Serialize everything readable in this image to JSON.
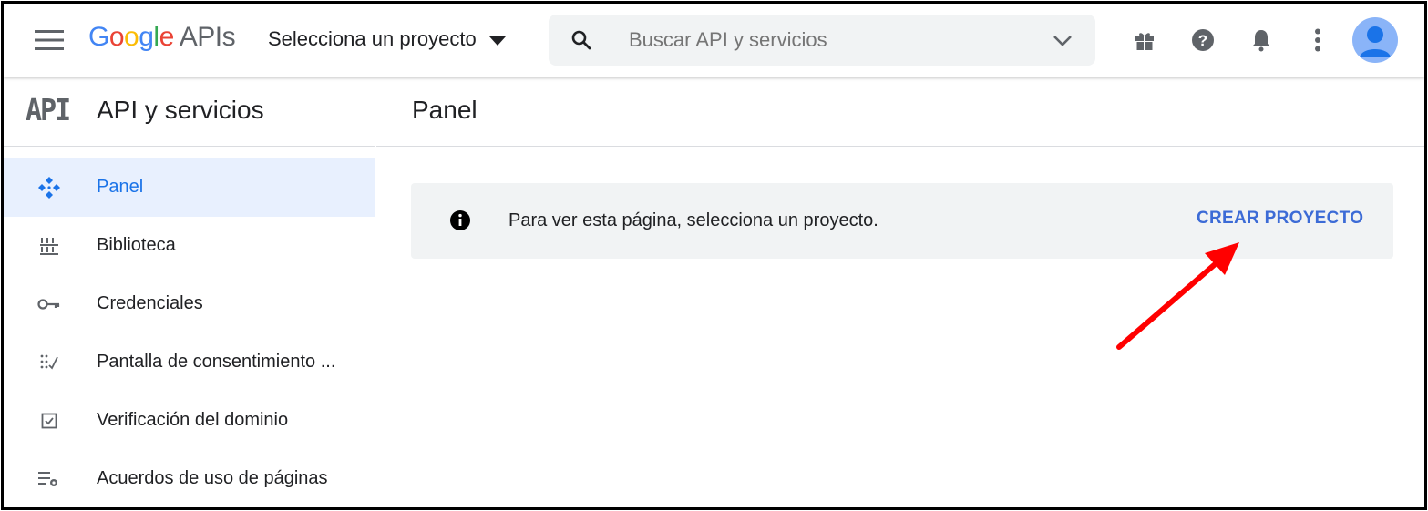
{
  "header": {
    "logo_google": [
      "G",
      "o",
      "o",
      "g",
      "l",
      "e"
    ],
    "logo_apis": "APIs",
    "project_selector": "Selecciona un proyecto",
    "search_placeholder": "Buscar API y servicios",
    "icons": [
      "menu-icon",
      "gift-icon",
      "help-icon",
      "bell-icon",
      "more-vert-icon",
      "account-icon"
    ]
  },
  "sidebar": {
    "logo": "API",
    "title": "API y servicios",
    "items": [
      {
        "label": "Panel",
        "icon": "dashboard-icon",
        "active": true
      },
      {
        "label": "Biblioteca",
        "icon": "library-icon",
        "active": false
      },
      {
        "label": "Credenciales",
        "icon": "key-icon",
        "active": false
      },
      {
        "label": "Pantalla de consentimiento ...",
        "icon": "consent-icon",
        "active": false
      },
      {
        "label": "Verificación del dominio",
        "icon": "checkbox-icon",
        "active": false
      },
      {
        "label": "Acuerdos de uso de páginas",
        "icon": "settings-list-icon",
        "active": false
      }
    ]
  },
  "main": {
    "title": "Panel",
    "banner": {
      "message": "Para ver esta página, selecciona un proyecto.",
      "cta": "CREAR PROYECTO"
    }
  },
  "colors": {
    "accent": "#1a73e8",
    "cta": "#3c6bd6",
    "annotation_arrow": "#ff0000",
    "active_bg": "#e8f0fe"
  }
}
